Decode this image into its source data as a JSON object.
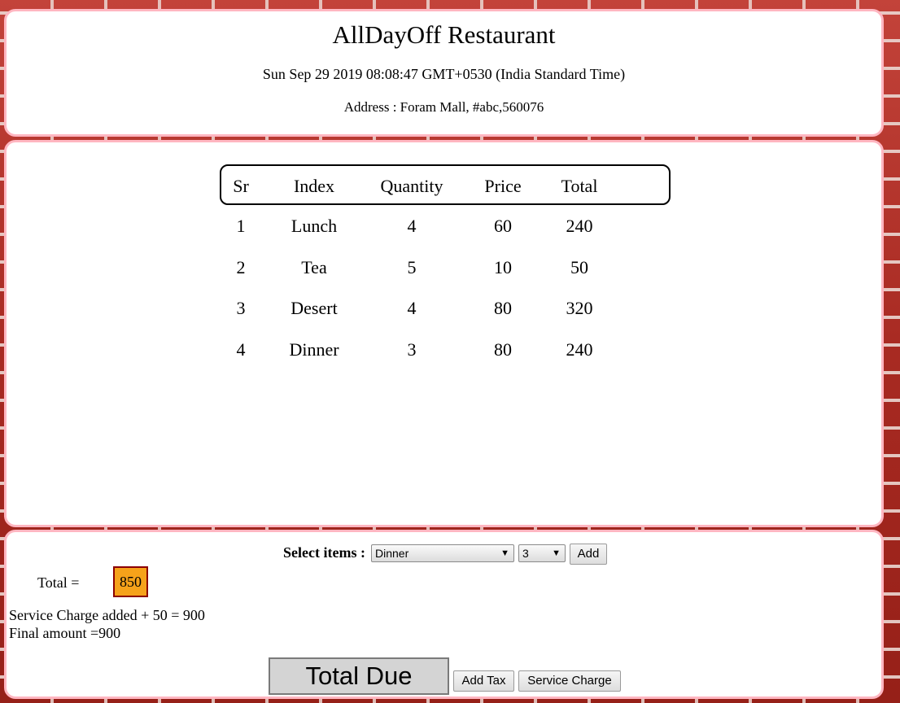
{
  "header": {
    "title": "AllDayOff Restaurant",
    "datetime": "Sun Sep 29 2019 08:08:47 GMT+0530 (India Standard Time)",
    "address": "Address : Foram Mall, #abc,560076"
  },
  "table": {
    "columns": [
      "Sr",
      "Index",
      "Quantity",
      "Price",
      "Total"
    ],
    "rows": [
      [
        "1",
        "Lunch",
        "4",
        "60",
        "240"
      ],
      [
        "2",
        "Tea",
        "5",
        "10",
        "50"
      ],
      [
        "3",
        "Desert",
        "4",
        "80",
        "320"
      ],
      [
        "4",
        "Dinner",
        "3",
        "80",
        "240"
      ]
    ]
  },
  "controls": {
    "select_label": "Select items :",
    "item_selected": "Dinner",
    "quantity_selected": "3",
    "add_label": "Add",
    "total_label": "Total =",
    "total_value": "850",
    "service_text": "Service Charge added + 50 = 900",
    "final_text": "Final amount =900",
    "total_due_label": "Total Due",
    "add_tax_label": "Add Tax",
    "service_charge_label": "Service Charge"
  },
  "colors": {
    "panel_border": "#ffb6c1",
    "total_highlight": "#f6a21a",
    "total_border": "#8b0000"
  }
}
